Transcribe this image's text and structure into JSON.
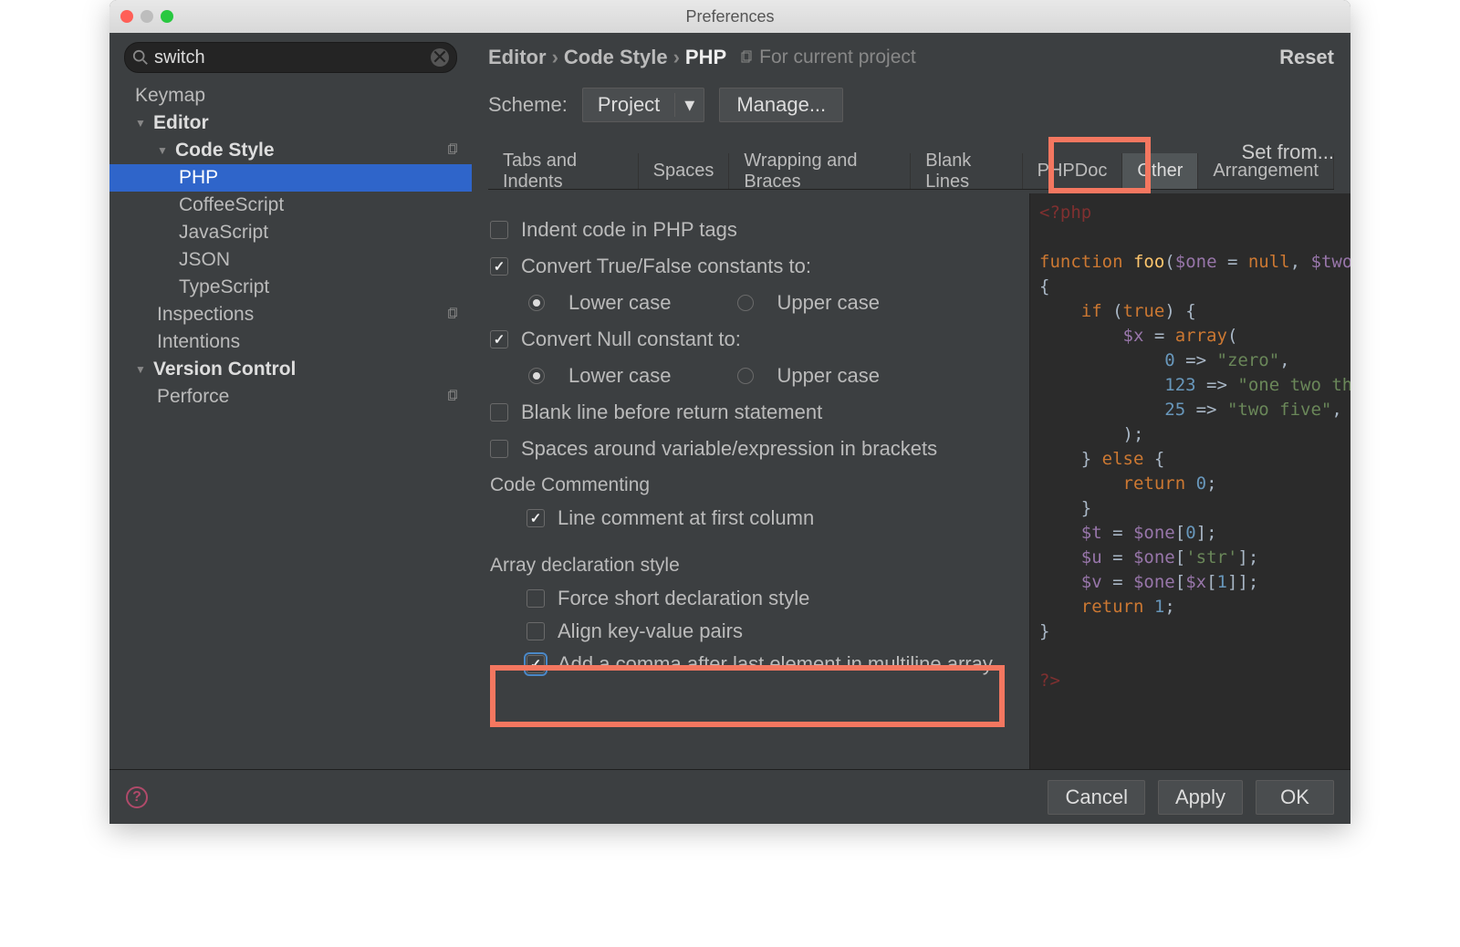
{
  "window": {
    "title": "Preferences"
  },
  "search": {
    "value": "switch",
    "placeholder": ""
  },
  "tree": {
    "items": [
      {
        "label": "Keymap",
        "level": 1
      },
      {
        "label": "Editor",
        "level": 1,
        "arrow": true,
        "bold": true
      },
      {
        "label": "Code Style",
        "level": 2,
        "arrow": true,
        "bold": true,
        "copy": true
      },
      {
        "label": "PHP",
        "level": 3,
        "selected": true
      },
      {
        "label": "CoffeeScript",
        "level": 3
      },
      {
        "label": "JavaScript",
        "level": 3
      },
      {
        "label": "JSON",
        "level": 3
      },
      {
        "label": "TypeScript",
        "level": 3
      },
      {
        "label": "Inspections",
        "level": 2,
        "copy": true
      },
      {
        "label": "Intentions",
        "level": 2
      },
      {
        "label": "Version Control",
        "level": 1,
        "arrow": true,
        "bold": true
      },
      {
        "label": "Perforce",
        "level": 2,
        "copy": true
      }
    ]
  },
  "breadcrumb": {
    "a": "Editor",
    "b": "Code Style",
    "c": "PHP",
    "scope": "For current project"
  },
  "reset": "Reset",
  "scheme": {
    "label": "Scheme:",
    "value": "Project",
    "manage": "Manage...",
    "setfrom": "Set from..."
  },
  "tabs": [
    "Tabs and Indents",
    "Spaces",
    "Wrapping and Braces",
    "Blank Lines",
    "PHPDoc",
    "Other",
    "Arrangement"
  ],
  "selected_tab": 5,
  "options": {
    "indent_php": "Indent code in PHP tags",
    "conv_tf": "Convert True/False constants to:",
    "lower": "Lower case",
    "upper": "Upper case",
    "conv_null": "Convert Null constant to:",
    "blank_return": "Blank line before return statement",
    "spaces_brackets": "Spaces around variable/expression in brackets",
    "code_commenting": "Code Commenting",
    "line_comment": "Line comment at first column",
    "array_style": "Array declaration style",
    "force_short": "Force short declaration style",
    "align_kv": "Align key-value pairs",
    "trailing_comma": "Add a comma after last element in multiline array"
  },
  "footer": {
    "cancel": "Cancel",
    "apply": "Apply",
    "ok": "OK"
  }
}
